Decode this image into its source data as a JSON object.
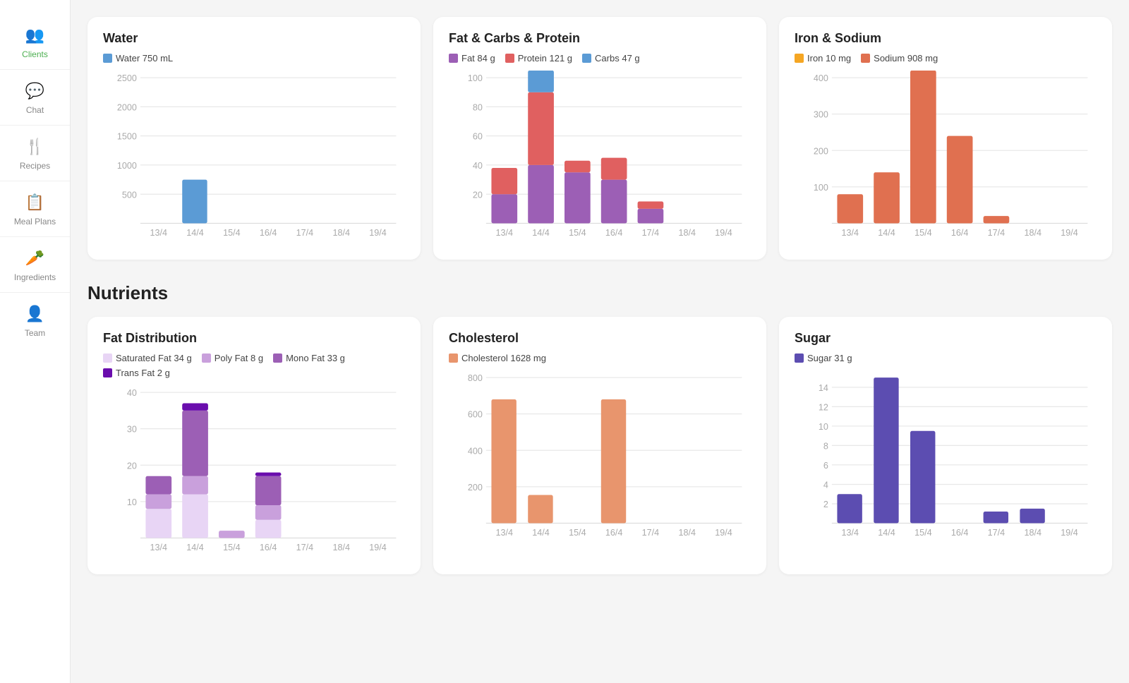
{
  "sidebar": {
    "items": [
      {
        "label": "Clients",
        "icon": "👥",
        "active": true
      },
      {
        "label": "Chat",
        "icon": "💬",
        "active": false
      },
      {
        "label": "Recipes",
        "icon": "🍴",
        "active": false
      },
      {
        "label": "Meal Plans",
        "icon": "📋",
        "active": false
      },
      {
        "label": "Ingredients",
        "icon": "🥕",
        "active": false
      },
      {
        "label": "Team",
        "icon": "👤",
        "active": false
      }
    ]
  },
  "sections": {
    "top": {
      "cards": [
        {
          "title": "Water",
          "legend": [
            {
              "color": "#5b9bd5",
              "label": "Water 750 mL"
            }
          ],
          "xLabels": [
            "13/4",
            "14/4",
            "15/4",
            "16/4",
            "17/4",
            "18/4",
            "19/4"
          ],
          "yMax": 2500,
          "yTicks": [
            500,
            1000,
            1500,
            2000,
            2500
          ],
          "series": [
            {
              "color": "#5b9bd5",
              "values": [
                0,
                750,
                0,
                0,
                0,
                0,
                0
              ]
            }
          ]
        },
        {
          "title": "Fat & Carbs & Protein",
          "legend": [
            {
              "color": "#9c5fb5",
              "label": "Fat 84 g"
            },
            {
              "color": "#e06060",
              "label": "Protein 121 g"
            },
            {
              "color": "#5b9bd5",
              "label": "Carbs 47 g"
            }
          ],
          "xLabels": [
            "13/4",
            "14/4",
            "15/4",
            "16/4",
            "17/4",
            "18/4",
            "19/4"
          ],
          "yMax": 100,
          "yTicks": [
            20,
            40,
            60,
            80,
            100
          ],
          "series": [
            {
              "color": "#9c5fb5",
              "values": [
                20,
                40,
                35,
                30,
                10,
                0,
                0
              ]
            },
            {
              "color": "#e06060",
              "values": [
                18,
                50,
                8,
                15,
                5,
                0,
                0
              ]
            },
            {
              "color": "#5b9bd5",
              "values": [
                0,
                15,
                0,
                0,
                0,
                0,
                0
              ]
            }
          ]
        },
        {
          "title": "Iron & Sodium",
          "legend": [
            {
              "color": "#f5a623",
              "label": "Iron 10 mg"
            },
            {
              "color": "#e07050",
              "label": "Sodium 908 mg"
            }
          ],
          "xLabels": [
            "13/4",
            "14/4",
            "15/4",
            "16/4",
            "17/4",
            "18/4",
            "19/4"
          ],
          "yMax": 400,
          "yTicks": [
            100,
            200,
            300,
            400
          ],
          "series": [
            {
              "color": "#f5a623",
              "values": [
                0,
                0,
                0,
                0,
                0,
                0,
                0
              ]
            },
            {
              "color": "#e07050",
              "values": [
                80,
                140,
                420,
                240,
                20,
                0,
                0
              ]
            }
          ]
        }
      ]
    },
    "nutrients": {
      "title": "Nutrients",
      "cards": [
        {
          "title": "Fat Distribution",
          "legend": [
            {
              "color": "#e8d5f5",
              "label": "Saturated Fat 34 g"
            },
            {
              "color": "#c9a0dc",
              "label": "Poly Fat 8 g"
            },
            {
              "color": "#9c5fb5",
              "label": "Mono Fat 33 g"
            },
            {
              "color": "#6a0dad",
              "label": "Trans Fat 2 g"
            }
          ],
          "xLabels": [
            "13/4",
            "14/4",
            "15/4",
            "16/4",
            "17/4",
            "18/4",
            "19/4"
          ],
          "yMax": 40,
          "yTicks": [
            10,
            20,
            30,
            40
          ],
          "series": [
            {
              "color": "#e8d5f5",
              "values": [
                8,
                12,
                0,
                5,
                0,
                0,
                0
              ]
            },
            {
              "color": "#c9a0dc",
              "values": [
                4,
                5,
                2,
                4,
                0,
                0,
                0
              ]
            },
            {
              "color": "#9c5fb5",
              "values": [
                5,
                18,
                0,
                8,
                0,
                0,
                0
              ]
            },
            {
              "color": "#6a0dad",
              "values": [
                0,
                2,
                0,
                1,
                0,
                0,
                0
              ]
            }
          ]
        },
        {
          "title": "Cholesterol",
          "legend": [
            {
              "color": "#e8956d",
              "label": "Cholesterol 1628 mg"
            }
          ],
          "xLabels": [
            "13/4",
            "14/4",
            "15/4",
            "16/4",
            "17/4",
            "18/4",
            "19/4"
          ],
          "yMax": 800,
          "yTicks": [
            200,
            400,
            600,
            800
          ],
          "series": [
            {
              "color": "#e8956d",
              "values": [
                680,
                155,
                0,
                680,
                0,
                0,
                0
              ]
            }
          ]
        },
        {
          "title": "Sugar",
          "legend": [
            {
              "color": "#5c4db1",
              "label": "Sugar 31 g"
            }
          ],
          "xLabels": [
            "13/4",
            "14/4",
            "15/4",
            "16/4",
            "17/4",
            "18/4",
            "19/4"
          ],
          "yMax": 15,
          "yTicks": [
            2,
            4,
            6,
            8,
            10,
            12,
            14
          ],
          "series": [
            {
              "color": "#5c4db1",
              "values": [
                3,
                15,
                9.5,
                0,
                1.2,
                1.5,
                0
              ]
            }
          ]
        }
      ]
    }
  }
}
